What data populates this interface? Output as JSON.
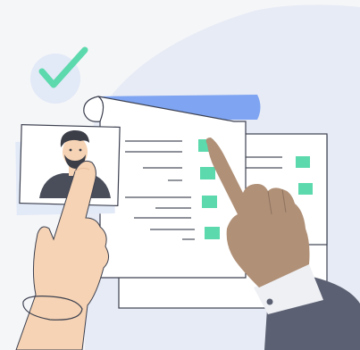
{
  "illustration": {
    "subject": "resume-review-checklist",
    "icons": [
      "checkmark-icon",
      "profile-photo-avatar",
      "checkbox-icon"
    ],
    "colors": {
      "background": "#f5f6f8",
      "blob": "#e7ebf5",
      "check_circle": "#e2e9f7",
      "check": "#5cd9ad",
      "paper": "#ffffff",
      "paper_edge": "#3d4150",
      "scroll_blue": "#7ea4f2",
      "line": "#4b4f5c",
      "checkbox": "#5cd9ad",
      "skin_light": "#f6d3b4",
      "skin_dark": "#b09077",
      "sleeve": "#5b6072",
      "cuff": "#eef0f4",
      "hair": "#3b3d47",
      "shirt": "#4a4e5b"
    }
  }
}
